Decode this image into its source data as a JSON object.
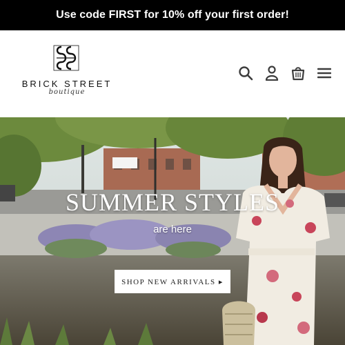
{
  "announcement": {
    "text": "Use code FIRST for 10% off your first order!"
  },
  "logo": {
    "monogram": "BS",
    "name": "BRICK STREET",
    "subtitle": "boutique"
  },
  "header_icons": [
    "search-icon",
    "account-icon",
    "cart-icon",
    "menu-icon"
  ],
  "hero": {
    "title": "SUMMER STYLES",
    "subtitle": "are here",
    "button_label": "SHOP NEW ARRIVALS ▸"
  },
  "colors": {
    "announcement_bg": "#000000",
    "announcement_text": "#ffffff",
    "accent": "#3c3c3c"
  }
}
